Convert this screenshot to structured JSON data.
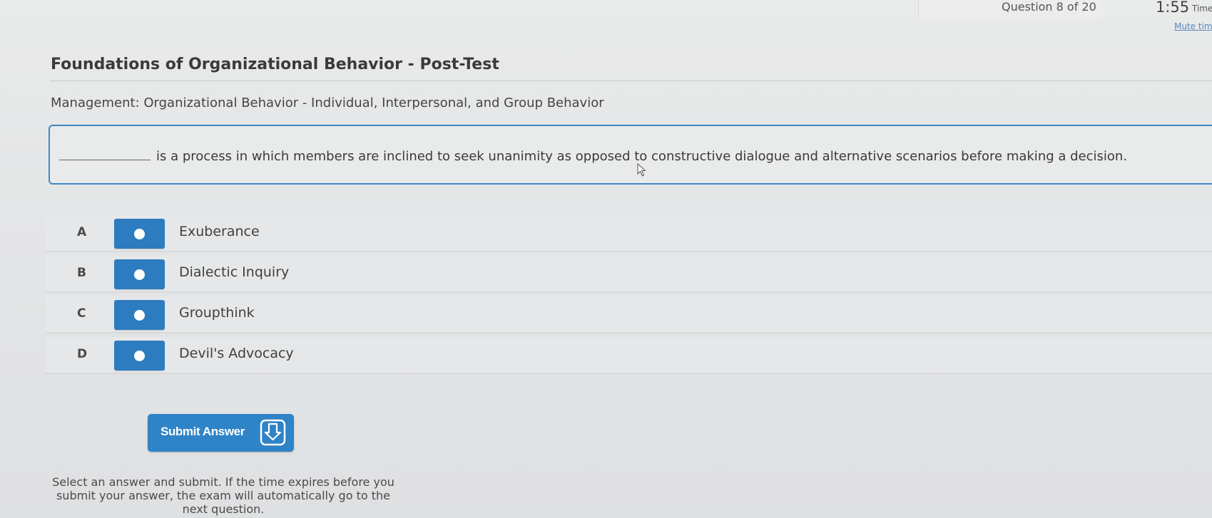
{
  "header": {
    "question_counter": "Question 8 of 20",
    "timer": "1:55",
    "timer_label": "Time",
    "mute_link": "Mute tim"
  },
  "exam": {
    "title": "Foundations of Organizational Behavior - Post-Test",
    "subject": "Management: Organizational Behavior - Individual, Interpersonal, and Group Behavior"
  },
  "question": {
    "text": "is a process in which members are inclined to seek unanimity as opposed to constructive dialogue and alternative scenarios before making a decision."
  },
  "options": [
    {
      "letter": "A",
      "label": "Exuberance"
    },
    {
      "letter": "B",
      "label": "Dialectic Inquiry"
    },
    {
      "letter": "C",
      "label": "Groupthink"
    },
    {
      "letter": "D",
      "label": "Devil's Advocacy"
    }
  ],
  "submit": {
    "label": "Submit Answer",
    "icon": "download-tray-icon"
  },
  "instructions": "Select an answer and submit. If the time expires before you submit your answer, the exam will automatically go to the next question.",
  "colors": {
    "accent": "#2f83c7",
    "question_border": "#3c88c6",
    "background": "#e6e7e8"
  }
}
